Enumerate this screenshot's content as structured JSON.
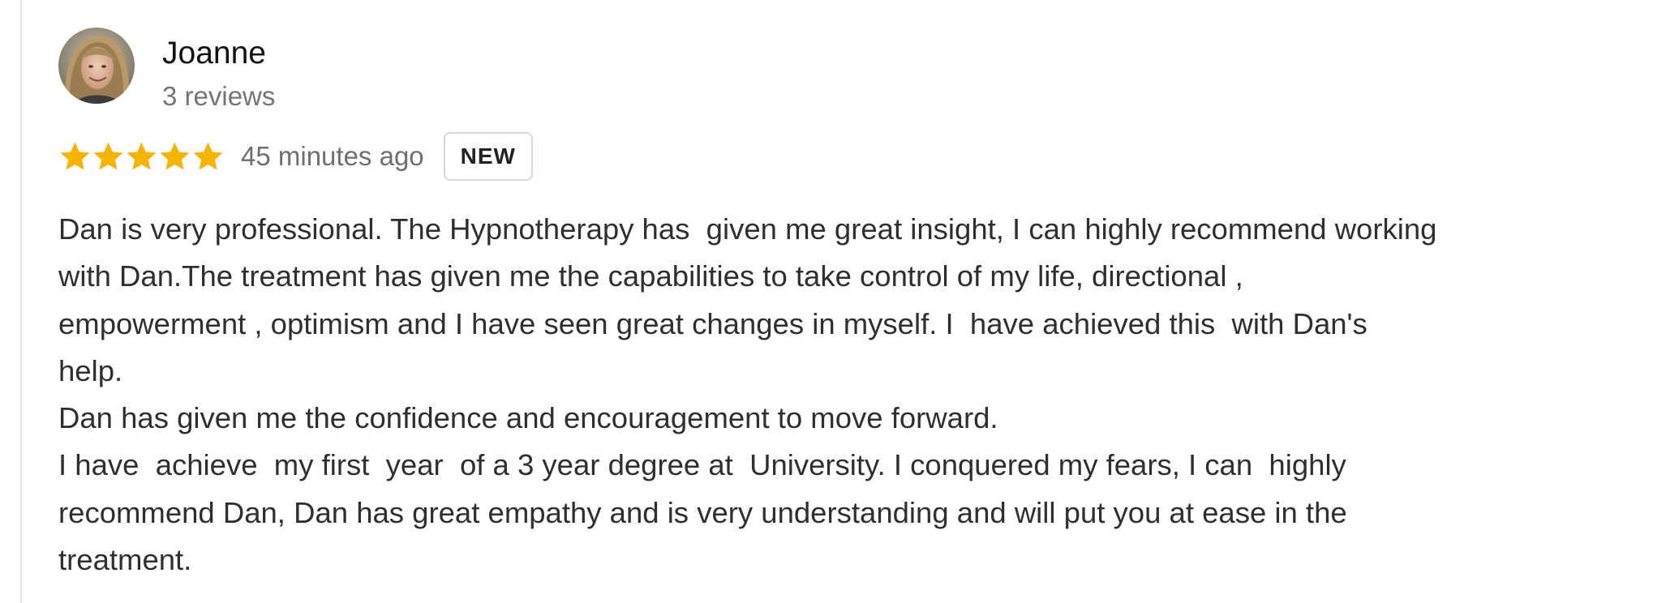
{
  "review": {
    "author": {
      "name": "Joanne",
      "meta": "3 reviews",
      "avatar_icon": "user-avatar-photo"
    },
    "rating": {
      "stars": 5,
      "max_stars": 5,
      "star_color": "#f4b400",
      "star_icon": "star-icon"
    },
    "time": "45 minutes ago",
    "badge": "NEW",
    "text_lines": [
      "Dan is very professional. The Hypnotherapy has  given me great insight, I can highly recommend working",
      "with Dan.The treatment has given me the capabilities to take control of my life, directional ,",
      "empowerment , optimism and I have seen great changes in myself. I  have achieved this  with Dan's",
      "help.",
      "Dan has given me the confidence and encouragement to move forward.",
      "I have  achieve  my first  year  of a 3 year degree at  University. I conquered my fears, I can  highly",
      "recommend Dan, Dan has great empathy and is very understanding and will put you at ease in the",
      "treatment."
    ]
  }
}
